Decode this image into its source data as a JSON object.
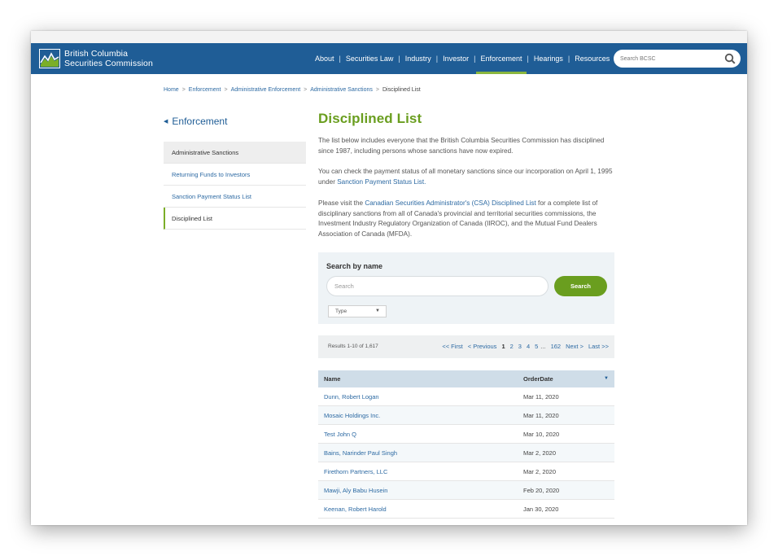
{
  "site": {
    "brand_line1": "British Columbia",
    "brand_line2": "Securities Commission",
    "accent_color": "#6a9e1f",
    "header_color": "#1f5d96"
  },
  "nav": {
    "items": [
      "About",
      "Securities Law",
      "Industry",
      "Investor",
      "Enforcement",
      "Hearings",
      "Resources"
    ],
    "active": "Enforcement",
    "search_placeholder": "Search BCSC"
  },
  "breadcrumb": [
    "Home",
    "Enforcement",
    "Administrative Enforcement",
    "Administrative Sanctions",
    "Disciplined List"
  ],
  "sidebar": {
    "heading": "Enforcement",
    "items": [
      "Administrative Sanctions",
      "Returning Funds to Investors",
      "Sanction Payment Status List",
      "Disciplined List"
    ]
  },
  "content": {
    "title": "Disciplined List",
    "p1": "The list below includes everyone that the British Columbia Securities Commission has disciplined since 1987, including persons whose sanctions have now expired.",
    "p2_text": "You can check the payment status of all monetary sanctions since our incorporation on April 1, 1995 under ",
    "p2_link": "Sanction Payment Status List.",
    "p3_pre": "Please visit the ",
    "p3_link": "Canadian Securities Administrator's (CSA) Disciplined List",
    "p3_post": " for a complete list of disciplinary sanctions from all of Canada's provincial and territorial securities commissions, the Investment Industry Regulatory Organization of Canada (IIROC), and the Mutual Fund Dealers Association of Canada (MFDA)."
  },
  "search": {
    "label": "Search by name",
    "placeholder": "Search",
    "button": "Search",
    "type_select": "Type"
  },
  "results": {
    "count": "Results 1-10 of 1,617",
    "pager": {
      "first": "<< First",
      "previous": "< Previous",
      "pages": [
        "1",
        "2",
        "3",
        "4",
        "5"
      ],
      "current": "1",
      "ellipsis": "...",
      "last_page": "162",
      "next": "Next >",
      "last": "Last >>"
    },
    "columns": [
      "Name",
      "OrderDate"
    ],
    "rows": [
      {
        "name": "Dunn, Robert Logan",
        "date": "Mar 11, 2020"
      },
      {
        "name": "Mosaic Holdings Inc.",
        "date": "Mar 11, 2020"
      },
      {
        "name": "Test John Q",
        "date": "Mar 10, 2020"
      },
      {
        "name": "Bains, Narinder Paul Singh",
        "date": "Mar 2, 2020"
      },
      {
        "name": "Firethorn Partners, LLC",
        "date": "Mar 2, 2020"
      },
      {
        "name": "Mawji, Aly Babu Husein",
        "date": "Feb 20, 2020"
      },
      {
        "name": "Keenan, Robert Harold",
        "date": "Jan 30, 2020"
      }
    ]
  }
}
